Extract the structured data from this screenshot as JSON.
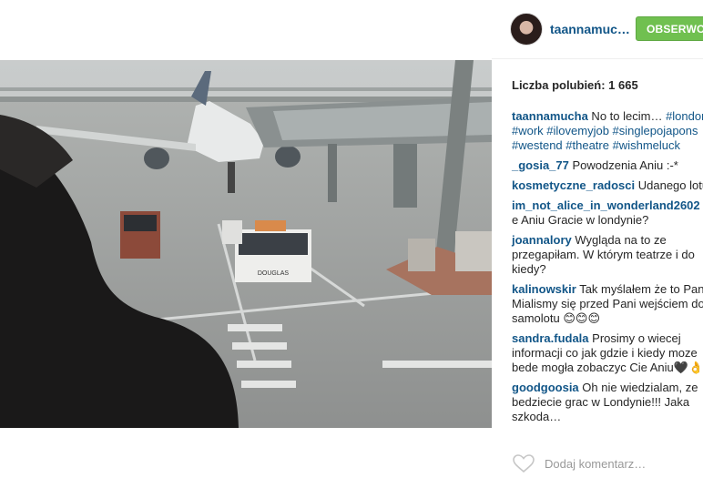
{
  "post": {
    "username": "taannamuc…",
    "follow_label": "OBSERWOWA",
    "likes_text": "Liczba polubień: 1 665",
    "add_comment_placeholder": "Dodaj komentarz…"
  },
  "caption": {
    "author": "taannamucha",
    "text": " No to lecim… ",
    "tags_inline": "#london",
    "tags_line2": "#work #ilovemyjob #singlepojapons",
    "tags_line3": "#westend #theatre #wishmeluck"
  },
  "comments": [
    {
      "author": "_gosia_77",
      "text": " Powodzenia Aniu :-*"
    },
    {
      "author": "kosmetyczne_radosci",
      "text": " Udanego lotu"
    },
    {
      "author": "im_not_alice_in_wonderland2602",
      "text": "e Aniu Gracie w londynie?"
    },
    {
      "author": "joannalory",
      "text": " Wygląda na to ze\nprzegapiłam. W którym teatrze i do\nkiedy?"
    },
    {
      "author": "kalinowskir",
      "text": " Tak myślałem że to Pani\nMialismy się przed Pani wejściem do\nsamolotu 😊😊😊"
    },
    {
      "author": "sandra.fudala",
      "text": " Prosimy o wiecej\ninformacji co jak gdzie i kiedy moze\nbede mogła zobaczyc Cie Aniu🖤👌"
    },
    {
      "author": "goodgoosia",
      "text": " Oh nie wiedzialam, ze\nbedziecie grac w Londynie!!! Jaka\nszkoda…"
    }
  ],
  "photo": {
    "truck_label": "DOUGLAS"
  },
  "icons": {
    "heart": "heart-outline-icon"
  },
  "colors": {
    "link": "#125688",
    "follow_bg": "#70c050"
  }
}
